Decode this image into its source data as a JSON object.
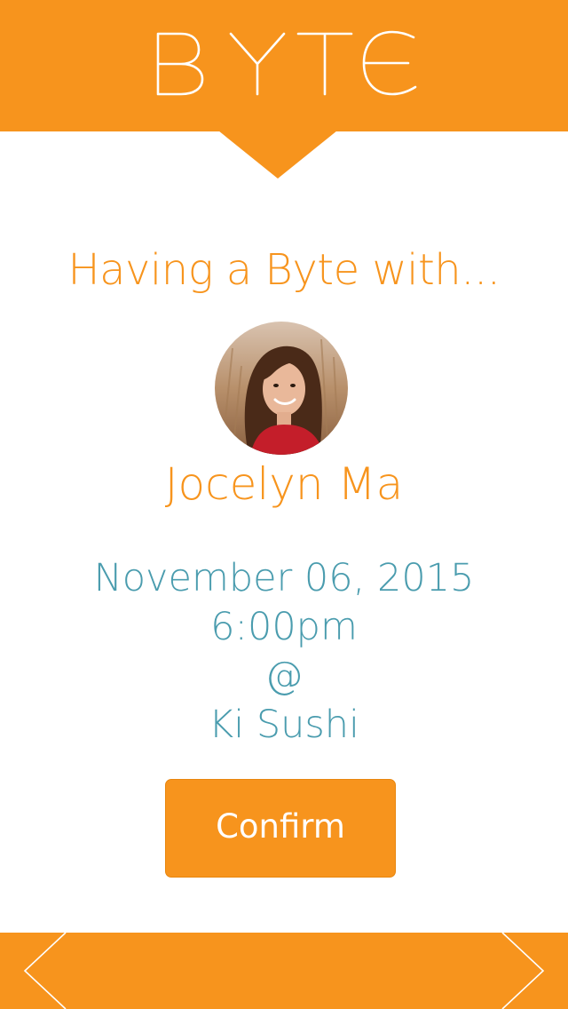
{
  "header": {
    "logo_text": "BYTE",
    "logo_icon": "byte-logo"
  },
  "main": {
    "heading": "Having a Byte with...",
    "avatar_icon": "profile-photo",
    "name": "Jocelyn Ma",
    "date": "November 06, 2015",
    "time": "6:00pm",
    "at_symbol": "@",
    "location": "Ki Sushi",
    "confirm_label": "Confirm"
  },
  "footer": {
    "prev_icon": "chevron-left-icon",
    "next_icon": "chevron-right-icon"
  },
  "colors": {
    "brand_orange": "#F7941D",
    "detail_teal": "#4A9CAE",
    "background": "#FFFFFF"
  }
}
